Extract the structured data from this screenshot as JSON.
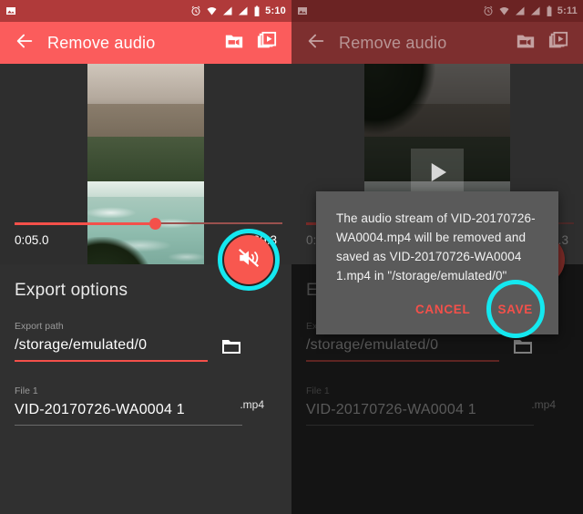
{
  "panels": [
    {
      "id": "left",
      "statusbar": {
        "time": "5:10",
        "icons": [
          "image-icon",
          "alarm-icon",
          "wifi-icon",
          "signal-icon",
          "signal-icon",
          "battery-icon"
        ]
      },
      "appbar": {
        "title": "Remove audio",
        "back_icon": "back-arrow-icon",
        "action_icons": [
          "video-folder-icon",
          "video-library-icon"
        ]
      },
      "timeline": {
        "start_time": "0:05.0",
        "end_time": "0:09.3",
        "thumb_percent": 53
      },
      "fab": {
        "icon": "volume-mute-icon",
        "highlighted": true
      },
      "sheet": {
        "heading": "Export options",
        "path_label": "Export path",
        "path_value": "/storage/emulated/0",
        "folder_icon": "folder-icon",
        "file_label": "File 1",
        "file_value": "VID-20170726-WA0004 1",
        "extension": ".mp4"
      }
    },
    {
      "id": "right",
      "statusbar": {
        "time": "5:11",
        "icons": [
          "image-icon",
          "alarm-icon",
          "wifi-icon",
          "signal-icon",
          "signal-icon",
          "battery-icon"
        ]
      },
      "appbar": {
        "title": "Remove audio",
        "back_icon": "back-arrow-icon",
        "action_icons": [
          "video-folder-icon",
          "video-library-icon"
        ]
      },
      "preview": {
        "play_icon": "play-icon"
      },
      "timeline": {
        "start_time": "0:05.0",
        "end_time": "0:09.3",
        "thumb_percent": 53
      },
      "fab": {
        "icon": "volume-mute-icon",
        "highlighted": false
      },
      "sheet": {
        "heading": "Export options",
        "path_label": "Export path",
        "path_value": "/storage/emulated/0",
        "folder_icon": "folder-icon",
        "file_label": "File 1",
        "file_value": "VID-20170726-WA0004 1",
        "extension": ".mp4"
      },
      "dialog": {
        "message": "The audio stream of VID-20170726-WA0004.mp4 will be removed and saved as VID-20170726-WA0004 1.mp4 in \"/storage/emulated/0\"",
        "cancel_label": "CANCEL",
        "save_label": "SAVE",
        "save_highlighted": true
      }
    }
  ],
  "colors": {
    "appbar_red": "#fb5c5c",
    "status_red": "#b03a3a",
    "accent_red": "#f4504a",
    "highlight_cyan": "#14e8f0",
    "sheet_bg": "#303030",
    "screen_bg": "#2e2e2e",
    "dialog_bg": "#5a5a5a"
  }
}
